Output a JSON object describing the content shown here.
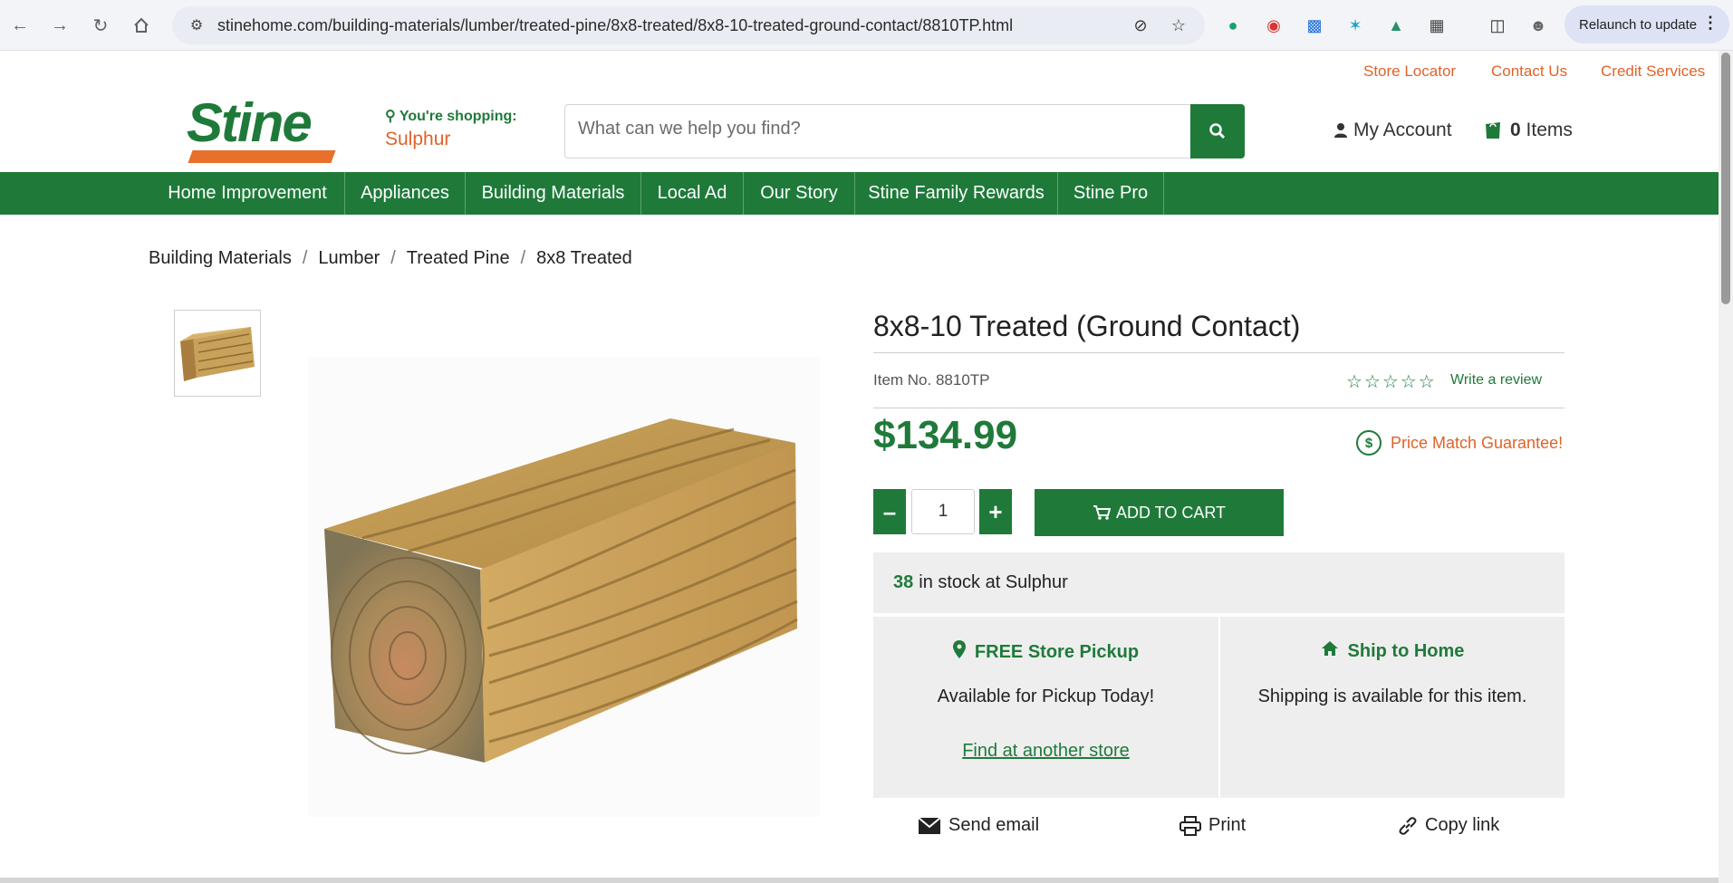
{
  "browser": {
    "url": "stinehome.com/building-materials/lumber/treated-pine/8x8-treated/8x8-10-treated-ground-contact/8810TP.html",
    "relaunch_label": "Relaunch to update"
  },
  "header": {
    "logo_text": "Stine",
    "top_links": [
      "Store Locator",
      "Contact Us",
      "Credit Services"
    ],
    "shopping_label": "You're shopping:",
    "store_name": "Sulphur",
    "search_placeholder": "What can we help you find?",
    "account_label": "My Account",
    "cart_count": "0",
    "cart_label": "Items"
  },
  "nav": {
    "items": [
      "Home Improvement",
      "Appliances",
      "Building Materials",
      "Local Ad",
      "Our Story",
      "Stine Family Rewards",
      "Stine Pro"
    ]
  },
  "breadcrumb": [
    "Building Materials",
    "Lumber",
    "Treated Pine",
    "8x8 Treated"
  ],
  "product": {
    "title": "8x8-10 Treated (Ground Contact)",
    "item_no": "Item No. 8810TP",
    "rating_stars": 0,
    "review_link": "Write a review",
    "price": "$134.99",
    "price_match": "Price Match Guarantee!",
    "quantity": "1",
    "add_to_cart": "ADD TO CART",
    "stock_count": "38",
    "stock_text": "in stock at Sulphur",
    "pickup_title": "FREE Store Pickup",
    "pickup_text": "Available for Pickup Today!",
    "pickup_link": "Find at another store",
    "ship_title": "Ship to Home",
    "ship_text": "Shipping is available for this item."
  },
  "share": {
    "email": "Send email",
    "print": "Print",
    "copy": "Copy link"
  },
  "colors": {
    "brand_green": "#1f7a3a",
    "accent_orange": "#e0622a"
  }
}
